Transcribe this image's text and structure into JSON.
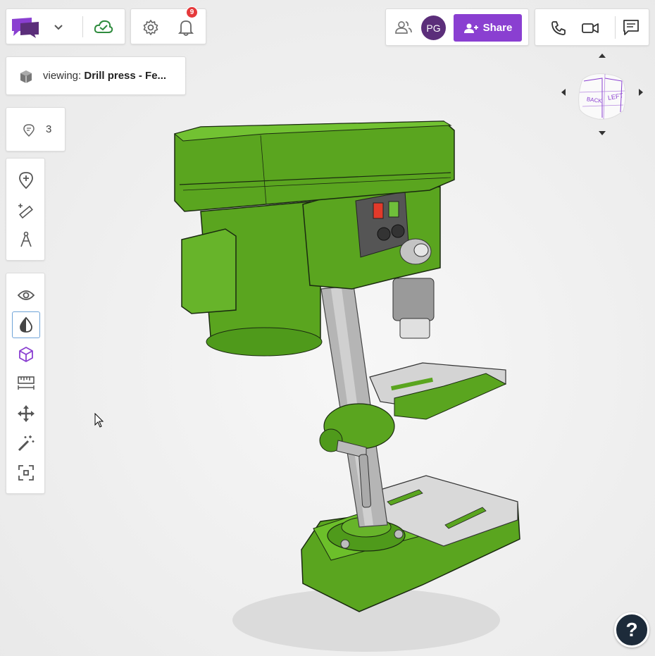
{
  "app": {
    "brand_color": "#8a3fd1",
    "cloud_status_color": "#2e8b3d",
    "notifications_count": "9"
  },
  "viewing": {
    "prefix": "viewing: ",
    "model_name": "Drill press - Fe..."
  },
  "pins": {
    "count": "3"
  },
  "collab": {
    "avatar_initials": "PG",
    "share_label": "Share"
  },
  "nav_cube": {
    "face_back": "BACK",
    "face_left": "LEFT"
  },
  "toolbar_top": [
    {
      "name": "add-pin-icon"
    },
    {
      "name": "measure-add-icon"
    },
    {
      "name": "compass-icon"
    }
  ],
  "toolbar_main": [
    {
      "name": "eye-icon"
    },
    {
      "name": "contrast-icon",
      "active": true
    },
    {
      "name": "cube-icon"
    },
    {
      "name": "ruler-icon"
    },
    {
      "name": "move-icon"
    },
    {
      "name": "magic-wand-icon"
    },
    {
      "name": "focus-icon"
    }
  ],
  "help": {
    "label": "?"
  },
  "model": {
    "body_color": "#5aa51f",
    "metal_color": "#c8c8c8"
  }
}
